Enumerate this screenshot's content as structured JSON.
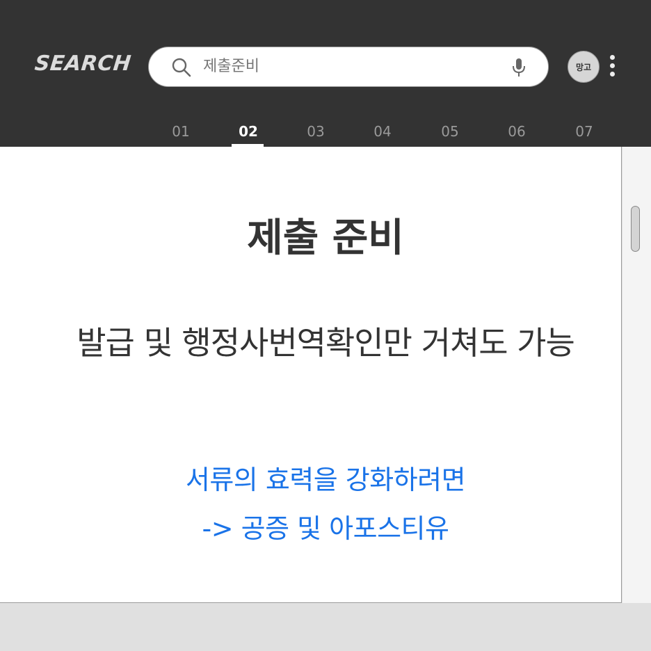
{
  "header": {
    "logo_text": "SEARCH",
    "search": {
      "value": "제출준비"
    },
    "avatar_text": "망고",
    "tabs": [
      "01",
      "02",
      "03",
      "04",
      "05",
      "06",
      "07"
    ],
    "active_tab_index": 1
  },
  "content": {
    "title": "제출 준비",
    "subtitle": "발급 및 행정사번역확인만 거쳐도 가능",
    "highlight_lines": [
      "서류의 효력을 강화하려면",
      "-> 공증 및 아포스티유"
    ],
    "highlight_color": "#1a73e8"
  },
  "colors": {
    "header_bg": "#333333",
    "page_bg": "#ffffff",
    "text_dark": "#333333"
  }
}
